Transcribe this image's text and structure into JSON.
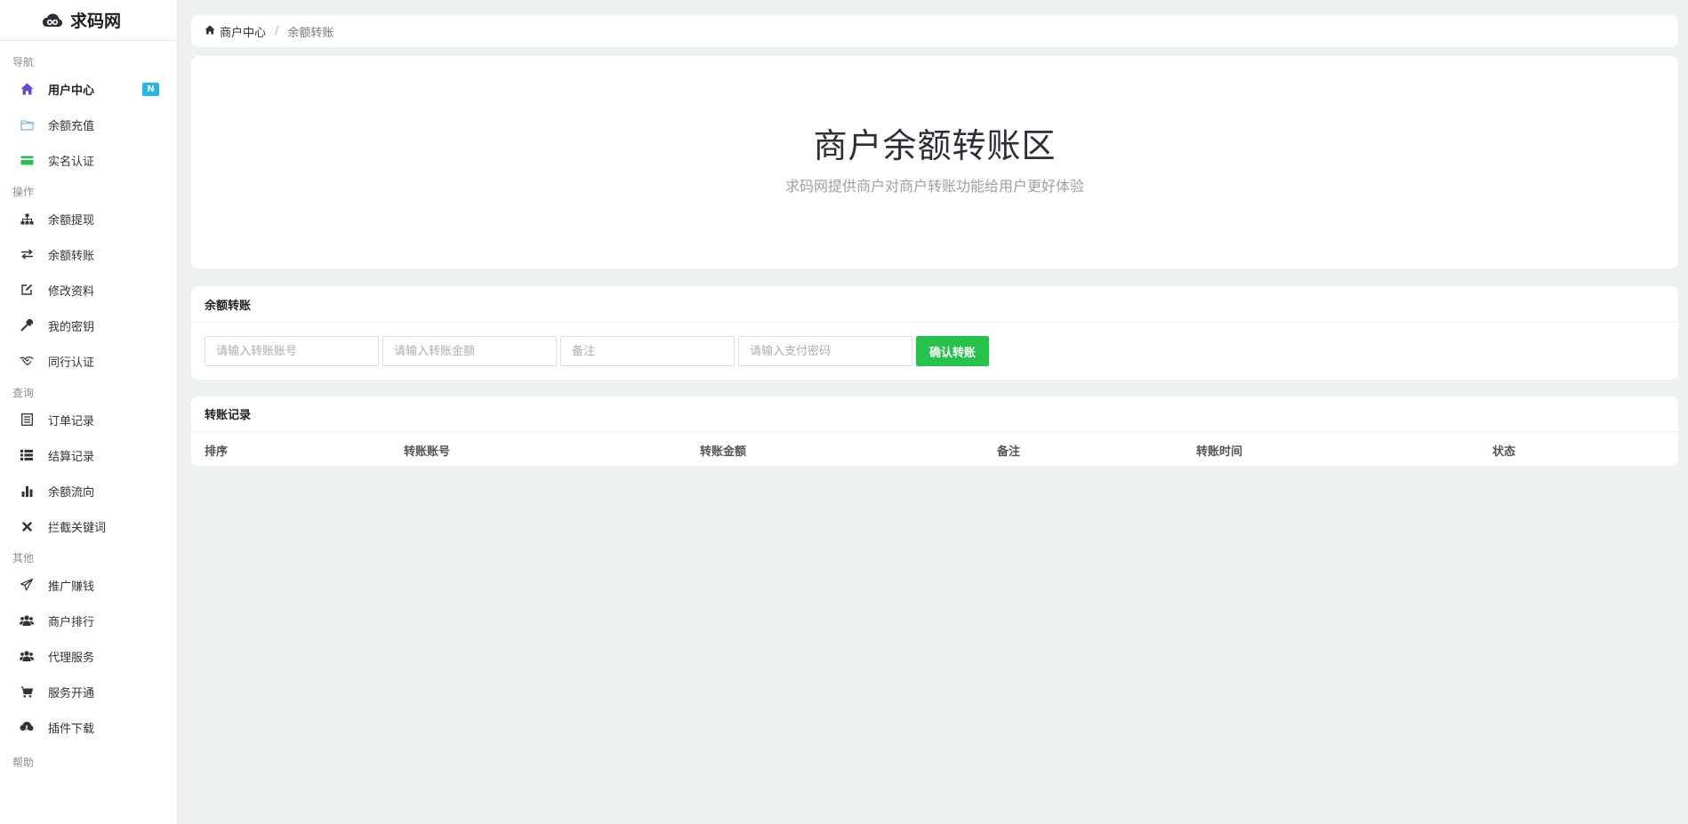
{
  "brand": {
    "name": "求码网",
    "icon": "cloud-logo-icon"
  },
  "sidebar": {
    "sections": [
      {
        "header": "导航",
        "items": [
          {
            "label": "用户中心",
            "icon": "home-icon",
            "active": true,
            "badge": "N"
          },
          {
            "label": "余额充值",
            "icon": "folder-icon"
          },
          {
            "label": "实名认证",
            "icon": "credit-card-icon"
          }
        ]
      },
      {
        "header": "操作",
        "items": [
          {
            "label": "余额提现",
            "icon": "sitemap-icon"
          },
          {
            "label": "余额转账",
            "icon": "exchange-icon"
          },
          {
            "label": "修改资料",
            "icon": "edit-icon"
          },
          {
            "label": "我的密钥",
            "icon": "wrench-icon"
          },
          {
            "label": "同行认证",
            "icon": "handshake-icon"
          }
        ]
      },
      {
        "header": "查询",
        "items": [
          {
            "label": "订单记录",
            "icon": "list-alt-icon"
          },
          {
            "label": "结算记录",
            "icon": "list-icon"
          },
          {
            "label": "余额流向",
            "icon": "bar-chart-icon"
          },
          {
            "label": "拦截关键词",
            "icon": "close-icon"
          }
        ]
      },
      {
        "header": "其他",
        "items": [
          {
            "label": "推广赚钱",
            "icon": "paper-plane-icon"
          },
          {
            "label": "商户排行",
            "icon": "users-icon"
          },
          {
            "label": "代理服务",
            "icon": "users-icon"
          },
          {
            "label": "服务开通",
            "icon": "cart-icon"
          },
          {
            "label": "插件下载",
            "icon": "cloud-download-icon"
          }
        ]
      },
      {
        "header": "帮助",
        "items": []
      }
    ]
  },
  "breadcrumb": {
    "home_label": "商户中心",
    "separator": "/",
    "current": "余额转账"
  },
  "hero": {
    "title": "商户余额转账区",
    "subtitle": "求码网提供商户对商户转账功能给用户更好体验"
  },
  "transfer_form": {
    "title": "余额转账",
    "account_placeholder": "请输入转账账号",
    "amount_placeholder": "请输入转账金额",
    "remark_placeholder": "备注",
    "password_placeholder": "请输入支付密码",
    "submit_label": "确认转账"
  },
  "records": {
    "title": "转账记录",
    "columns": [
      "排序",
      "转账账号",
      "转账金额",
      "备注",
      "转账时间",
      "状态"
    ],
    "rows": []
  },
  "colors": {
    "accent_green": "#27c24c",
    "badge_blue": "#23b7e5",
    "home_icon_purple": "#5a4fcf",
    "card_icon_green": "#27c24c",
    "background": "#eef1f2"
  }
}
